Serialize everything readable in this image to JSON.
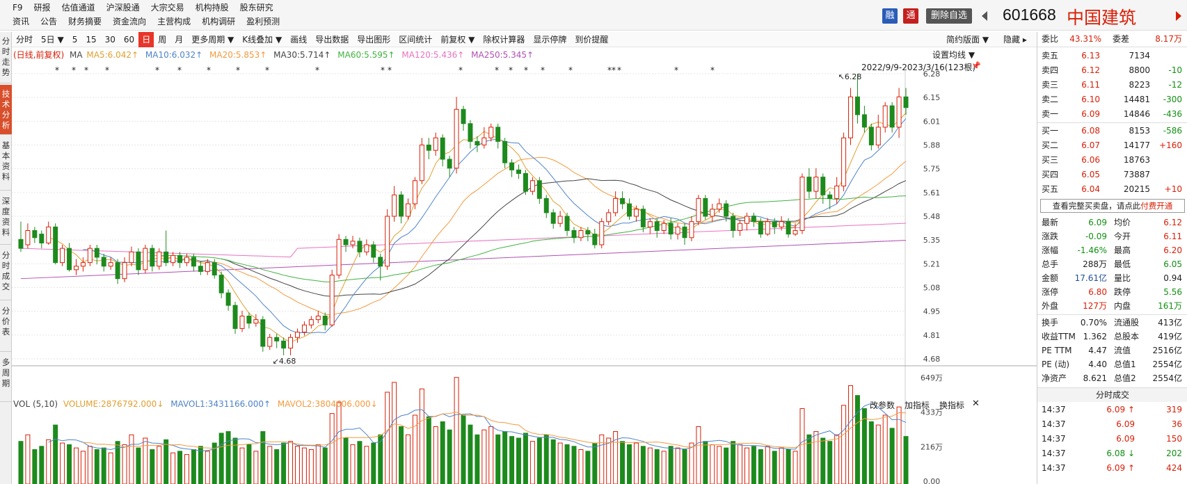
{
  "top_menu": {
    "row1": [
      "F9",
      "研报",
      "估值通道",
      "沪深股通",
      "大宗交易",
      "机构持股",
      "股东研究"
    ],
    "row2": [
      "资讯",
      "公告",
      "财务摘要",
      "资金流向",
      "主营构成",
      "机构调研",
      "盈利预测"
    ]
  },
  "header": {
    "rong": "融",
    "tong": "通",
    "remove_fav": "删除自选",
    "code": "601668",
    "name": "中国建筑"
  },
  "left_tabs": [
    "分时走势",
    "技术分析",
    "基本资料",
    "深度资料",
    "分时成交",
    "分价表",
    "多周期"
  ],
  "toolbar": {
    "items": [
      "分时",
      "5日 ▼",
      "5",
      "15",
      "30",
      "60",
      "日",
      "周",
      "月",
      "更多周期 ▼",
      "K线叠加 ▼",
      "画线",
      "导出数据",
      "导出图形",
      "区间统计",
      "前复权 ▼",
      "除权计算器",
      "显示停牌",
      "到价提醒"
    ],
    "selected": "日",
    "right1": "简约版面 ▼",
    "right2": "隐藏 ▸"
  },
  "ma_legend": {
    "prefix": "(日线,前复权)",
    "ma": "MA",
    "ma5": "MA5:6.042↑",
    "ma10": "MA10:6.032↑",
    "ma20": "MA20:5.853↑",
    "ma30": "MA30:5.714↑",
    "ma60": "MA60:5.595↑",
    "ma120": "MA120:5.436↑",
    "ma250": "MA250:5.345↑",
    "colors": {
      "ma5": "#e0a030",
      "ma10": "#4e83c9",
      "ma20": "#f39a3d",
      "ma30": "#444444",
      "ma60": "#3fb23f",
      "ma120": "#e872c0",
      "ma250": "#b04fb4"
    }
  },
  "chart_header": {
    "settings": "设置均线 ▼",
    "range": "2022/9/9-2023/3/16(123根)",
    "high_label": "↖6.28",
    "low_label": "↙4.68"
  },
  "price_axis": [
    "6.28",
    "6.15",
    "6.01",
    "5.88",
    "5.75",
    "5.61",
    "5.48",
    "5.35",
    "5.21",
    "5.08",
    "4.95",
    "4.81",
    "4.68"
  ],
  "volume_legend": {
    "vol": "VOL (5,10)",
    "volume": "VOLUME:2876792.000↓",
    "mavol1": "MAVOL1:3431166.000↑",
    "mavol2": "MAVOL2:3804606.000↓",
    "change_params": "改参数",
    "add_indicator": "加指标",
    "switch_indicator": "换指标",
    "close": "✕"
  },
  "vol_axis": [
    "649万",
    "433万",
    "216万",
    "0.00"
  ],
  "order_book": {
    "weibi_label": "委比",
    "weibi": "43.31%",
    "weicha_label": "委差",
    "weicha": "8.17万",
    "asks": [
      {
        "label": "卖五",
        "price": "6.13",
        "vol": "7134",
        "chg": ""
      },
      {
        "label": "卖四",
        "price": "6.12",
        "vol": "8800",
        "chg": "-10"
      },
      {
        "label": "卖三",
        "price": "6.11",
        "vol": "8223",
        "chg": "-12"
      },
      {
        "label": "卖二",
        "price": "6.10",
        "vol": "14481",
        "chg": "-300"
      },
      {
        "label": "卖一",
        "price": "6.09",
        "vol": "14846",
        "chg": "-436"
      }
    ],
    "bids": [
      {
        "label": "买一",
        "price": "6.08",
        "vol": "8153",
        "chg": "-586"
      },
      {
        "label": "买二",
        "price": "6.07",
        "vol": "14177",
        "chg": "+160"
      },
      {
        "label": "买三",
        "price": "6.06",
        "vol": "18763",
        "chg": ""
      },
      {
        "label": "买四",
        "price": "6.05",
        "vol": "73887",
        "chg": ""
      },
      {
        "label": "买五",
        "price": "6.04",
        "vol": "20215",
        "chg": "+10"
      }
    ],
    "full_book": "查看完整买卖盘，请点此",
    "pay": "付费开通"
  },
  "quote": [
    {
      "l1": "最新",
      "v1": "6.09",
      "c1": "green",
      "l2": "均价",
      "v2": "6.12",
      "c2": "red"
    },
    {
      "l1": "涨跌",
      "v1": "-0.09",
      "c1": "green",
      "l2": "今开",
      "v2": "6.11",
      "c2": "red"
    },
    {
      "l1": "涨幅",
      "v1": "-1.46%",
      "c1": "green",
      "l2": "最高",
      "v2": "6.20",
      "c2": "red"
    },
    {
      "l1": "总手",
      "v1": "288万",
      "c1": "",
      "l2": "最低",
      "v2": "6.05",
      "c2": "green"
    },
    {
      "l1": "金额",
      "v1": "17.61亿",
      "c1": "blue",
      "l2": "量比",
      "v2": "0.94",
      "c2": ""
    },
    {
      "l1": "涨停",
      "v1": "6.80",
      "c1": "red",
      "l2": "跌停",
      "v2": "5.56",
      "c2": "green"
    },
    {
      "l1": "外盘",
      "v1": "127万",
      "c1": "red",
      "l2": "内盘",
      "v2": "161万",
      "c2": "green"
    }
  ],
  "fundamentals": [
    {
      "l1": "换手",
      "v1": "0.70%",
      "l2": "流通股",
      "v2": "413亿"
    },
    {
      "l1": "收益TTM",
      "v1": "1.362",
      "l2": "总股本",
      "v2": "419亿"
    },
    {
      "l1": "PE TTM",
      "v1": "4.47",
      "l2": "流值",
      "v2": "2516亿"
    },
    {
      "l1": "PE (动)",
      "v1": "4.40",
      "l2": "总值1",
      "v2": "2554亿"
    },
    {
      "l1": "净资产",
      "v1": "8.621",
      "l2": "总值2",
      "v2": "2554亿"
    }
  ],
  "ticks_title": "分时成交",
  "ticks": [
    {
      "t": "14:37",
      "p": "6.09",
      "a": "↑",
      "v": "319",
      "c": "red"
    },
    {
      "t": "14:37",
      "p": "6.09",
      "a": "",
      "v": "36",
      "c": "red"
    },
    {
      "t": "14:37",
      "p": "6.09",
      "a": "",
      "v": "150",
      "c": "red"
    },
    {
      "t": "14:37",
      "p": "6.08",
      "a": "↓",
      "v": "202",
      "c": "green"
    },
    {
      "t": "14:37",
      "p": "6.09",
      "a": "↑",
      "v": "424",
      "c": "red"
    }
  ],
  "chart_data": {
    "type": "candlestick",
    "y_range": [
      4.68,
      6.28
    ],
    "candles": [
      [
        5.35,
        5.3,
        5.45,
        5.28
      ],
      [
        5.32,
        5.4,
        5.44,
        5.3
      ],
      [
        5.4,
        5.36,
        5.42,
        5.33
      ],
      [
        5.38,
        5.33,
        5.4,
        5.3
      ],
      [
        5.33,
        5.42,
        5.45,
        5.32
      ],
      [
        5.42,
        5.22,
        5.44,
        5.21
      ],
      [
        5.22,
        5.3,
        5.32,
        5.2
      ],
      [
        5.3,
        5.18,
        5.33,
        5.17
      ],
      [
        5.18,
        5.2,
        5.24,
        5.15
      ],
      [
        5.2,
        5.22,
        5.25,
        5.17
      ],
      [
        5.22,
        5.3,
        5.32,
        5.2
      ],
      [
        5.3,
        5.25,
        5.32,
        5.21
      ],
      [
        5.25,
        5.2,
        5.27,
        5.17
      ],
      [
        5.2,
        5.22,
        5.25,
        5.18
      ],
      [
        5.22,
        5.13,
        5.24,
        5.1
      ],
      [
        5.13,
        5.22,
        5.25,
        5.11
      ],
      [
        5.22,
        5.28,
        5.31,
        5.2
      ],
      [
        5.28,
        5.18,
        5.3,
        5.15
      ],
      [
        5.18,
        5.3,
        5.32,
        5.16
      ],
      [
        5.3,
        5.2,
        5.32,
        5.17
      ],
      [
        5.2,
        5.28,
        5.3,
        5.18
      ],
      [
        5.28,
        5.22,
        5.4,
        5.2
      ],
      [
        5.22,
        5.26,
        5.28,
        5.2
      ],
      [
        5.26,
        5.22,
        5.28,
        5.19
      ],
      [
        5.22,
        5.25,
        5.27,
        5.2
      ],
      [
        5.25,
        5.2,
        5.27,
        5.17
      ],
      [
        5.2,
        5.17,
        5.23,
        5.15
      ],
      [
        5.17,
        5.22,
        5.24,
        5.15
      ],
      [
        5.22,
        5.15,
        5.24,
        5.13
      ],
      [
        5.15,
        5.05,
        5.17,
        5.02
      ],
      [
        5.05,
        4.98,
        5.07,
        4.95
      ],
      [
        4.98,
        4.85,
        5.0,
        4.82
      ],
      [
        4.85,
        4.92,
        4.95,
        4.83
      ],
      [
        4.92,
        4.88,
        4.94,
        4.85
      ],
      [
        4.88,
        4.9,
        4.93,
        4.86
      ],
      [
        4.9,
        4.75,
        4.92,
        4.72
      ],
      [
        4.75,
        4.8,
        4.82,
        4.73
      ],
      [
        4.8,
        4.78,
        4.82,
        4.74
      ],
      [
        4.78,
        4.74,
        4.8,
        4.7
      ],
      [
        4.74,
        4.8,
        4.82,
        4.7
      ],
      [
        4.8,
        4.83,
        4.85,
        4.77
      ],
      [
        4.83,
        4.87,
        4.89,
        4.81
      ],
      [
        4.87,
        4.9,
        4.92,
        4.85
      ],
      [
        4.9,
        4.92,
        4.95,
        4.88
      ],
      [
        4.92,
        4.87,
        4.94,
        4.84
      ],
      [
        4.87,
        5.15,
        5.18,
        4.86
      ],
      [
        5.15,
        5.35,
        5.38,
        5.13
      ],
      [
        5.35,
        5.32,
        5.37,
        5.28
      ],
      [
        5.32,
        5.34,
        5.37,
        5.3
      ],
      [
        5.34,
        5.28,
        5.36,
        5.25
      ],
      [
        5.28,
        5.32,
        5.35,
        5.26
      ],
      [
        5.32,
        5.25,
        5.34,
        5.22
      ],
      [
        5.25,
        5.2,
        5.27,
        5.12
      ],
      [
        5.2,
        5.48,
        5.52,
        5.18
      ],
      [
        5.48,
        5.6,
        5.65,
        5.45
      ],
      [
        5.6,
        5.48,
        5.62,
        5.44
      ],
      [
        5.48,
        5.55,
        5.58,
        5.46
      ],
      [
        5.55,
        5.68,
        5.7,
        5.52
      ],
      [
        5.68,
        5.88,
        5.92,
        5.66
      ],
      [
        5.88,
        5.85,
        5.92,
        5.8
      ],
      [
        5.85,
        5.92,
        5.95,
        5.82
      ],
      [
        5.92,
        5.8,
        5.94,
        5.76
      ],
      [
        5.8,
        5.75,
        5.82,
        5.7
      ],
      [
        5.75,
        6.08,
        6.15,
        5.72
      ],
      [
        6.08,
        6.0,
        6.1,
        5.96
      ],
      [
        6.0,
        5.9,
        6.02,
        5.86
      ],
      [
        5.9,
        5.88,
        5.93,
        5.84
      ],
      [
        5.88,
        5.92,
        5.98,
        5.86
      ],
      [
        5.92,
        5.98,
        6.0,
        5.9
      ],
      [
        5.98,
        5.9,
        6.0,
        5.86
      ],
      [
        5.9,
        5.78,
        5.92,
        5.75
      ],
      [
        5.78,
        5.74,
        5.8,
        5.7
      ],
      [
        5.74,
        5.72,
        5.77,
        5.69
      ],
      [
        5.72,
        5.62,
        5.74,
        5.6
      ],
      [
        5.62,
        5.68,
        5.7,
        5.6
      ],
      [
        5.68,
        5.58,
        5.7,
        5.55
      ],
      [
        5.58,
        5.5,
        5.6,
        5.47
      ],
      [
        5.5,
        5.44,
        5.52,
        5.41
      ],
      [
        5.44,
        5.48,
        5.51,
        5.42
      ],
      [
        5.48,
        5.4,
        5.5,
        5.37
      ],
      [
        5.4,
        5.36,
        5.42,
        5.33
      ],
      [
        5.36,
        5.4,
        5.42,
        5.34
      ],
      [
        5.4,
        5.38,
        5.42,
        5.34
      ],
      [
        5.38,
        5.32,
        5.41,
        5.3
      ],
      [
        5.32,
        5.45,
        5.47,
        5.3
      ],
      [
        5.45,
        5.5,
        5.52,
        5.43
      ],
      [
        5.5,
        5.58,
        5.62,
        5.48
      ],
      [
        5.58,
        5.55,
        5.62,
        5.52
      ],
      [
        5.55,
        5.48,
        5.58,
        5.46
      ],
      [
        5.48,
        5.52,
        5.54,
        5.45
      ],
      [
        5.52,
        5.42,
        5.54,
        5.39
      ],
      [
        5.42,
        5.45,
        5.47,
        5.38
      ],
      [
        5.45,
        5.4,
        5.47,
        5.36
      ],
      [
        5.4,
        5.44,
        5.46,
        5.38
      ],
      [
        5.44,
        5.38,
        5.47,
        5.35
      ],
      [
        5.38,
        5.42,
        5.44,
        5.35
      ],
      [
        5.42,
        5.36,
        5.44,
        5.32
      ],
      [
        5.36,
        5.45,
        5.48,
        5.34
      ],
      [
        5.45,
        5.58,
        5.6,
        5.43
      ],
      [
        5.58,
        5.48,
        5.6,
        5.46
      ],
      [
        5.48,
        5.52,
        5.55,
        5.45
      ],
      [
        5.52,
        5.55,
        5.58,
        5.5
      ],
      [
        5.55,
        5.48,
        5.57,
        5.45
      ],
      [
        5.48,
        5.4,
        5.5,
        5.36
      ],
      [
        5.4,
        5.44,
        5.46,
        5.37
      ],
      [
        5.44,
        5.48,
        5.5,
        5.4
      ],
      [
        5.48,
        5.45,
        5.5,
        5.42
      ],
      [
        5.45,
        5.38,
        5.47,
        5.36
      ],
      [
        5.38,
        5.45,
        5.47,
        5.37
      ],
      [
        5.45,
        5.42,
        5.47,
        5.38
      ],
      [
        5.42,
        5.45,
        5.48,
        5.4
      ],
      [
        5.45,
        5.38,
        5.47,
        5.36
      ],
      [
        5.38,
        5.4,
        5.44,
        5.37
      ],
      [
        5.4,
        5.7,
        5.72,
        5.38
      ],
      [
        5.7,
        5.62,
        5.75,
        5.58
      ],
      [
        5.62,
        5.7,
        5.75,
        5.58
      ],
      [
        5.7,
        5.6,
        5.72,
        5.55
      ],
      [
        5.6,
        5.58,
        5.62,
        5.52
      ],
      [
        5.58,
        5.65,
        5.7,
        5.55
      ],
      [
        5.65,
        5.92,
        5.95,
        5.62
      ],
      [
        5.92,
        6.15,
        6.2,
        5.88
      ],
      [
        6.15,
        6.05,
        6.28,
        6.0
      ],
      [
        6.05,
        5.98,
        6.1,
        5.95
      ],
      [
        5.98,
        5.88,
        6.0,
        5.85
      ],
      [
        5.88,
        5.98,
        6.05,
        5.86
      ],
      [
        5.98,
        6.1,
        6.12,
        5.95
      ],
      [
        6.1,
        5.98,
        6.12,
        5.95
      ],
      [
        5.98,
        6.15,
        6.2,
        5.92
      ],
      [
        6.15,
        6.09,
        6.2,
        6.05
      ]
    ],
    "volumes": [
      260,
      300,
      210,
      230,
      270,
      360,
      250,
      240,
      220,
      200,
      230,
      210,
      220,
      190,
      260,
      240,
      300,
      220,
      280,
      210,
      230,
      270,
      190,
      200,
      180,
      210,
      230,
      200,
      250,
      310,
      320,
      280,
      220,
      240,
      200,
      320,
      230,
      210,
      250,
      260,
      230,
      220,
      210,
      240,
      220,
      430,
      500,
      280,
      240,
      260,
      230,
      250,
      300,
      560,
      620,
      350,
      300,
      420,
      580,
      410,
      350,
      380,
      330,
      650,
      420,
      360,
      300,
      330,
      350,
      300,
      320,
      290,
      280,
      310,
      260,
      280,
      300,
      270,
      250,
      240,
      230,
      210,
      200,
      250,
      300,
      280,
      320,
      260,
      240,
      250,
      230,
      220,
      210,
      200,
      230,
      220,
      210,
      250,
      350,
      260,
      240,
      230,
      220,
      260,
      240,
      220,
      230,
      210,
      230,
      200,
      220,
      210,
      200,
      460,
      300,
      320,
      280,
      260,
      300,
      480,
      600,
      540,
      460,
      380,
      360,
      420,
      340,
      470,
      290
    ]
  }
}
